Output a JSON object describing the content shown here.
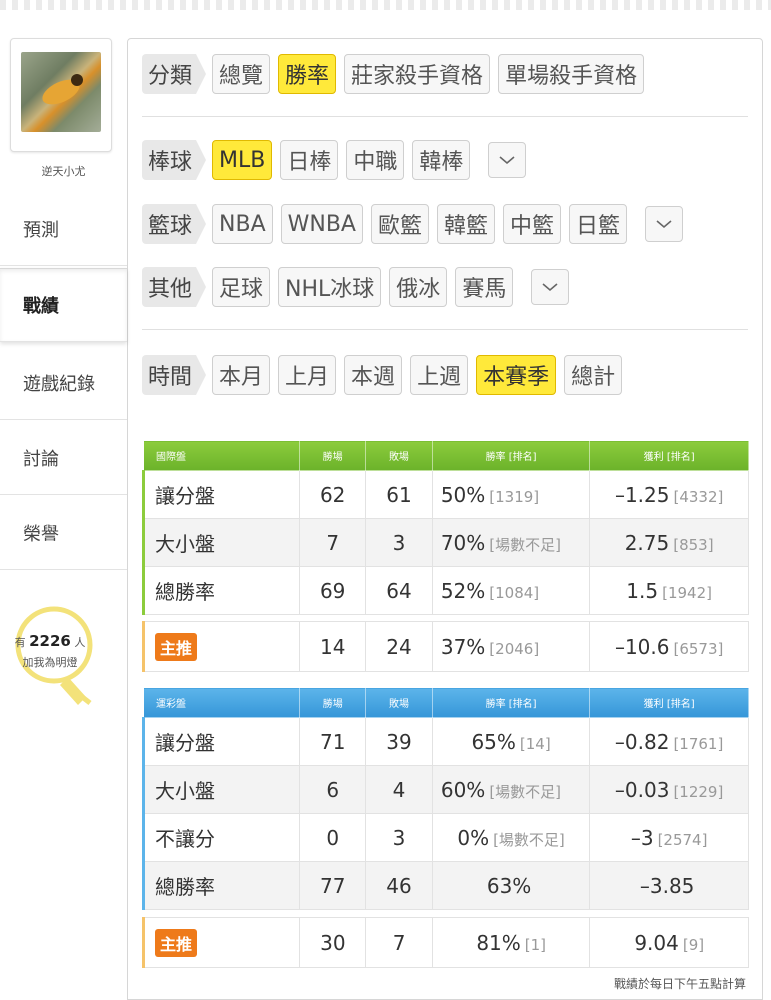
{
  "user": {
    "name": "逆天小尤"
  },
  "sidebar": {
    "items": [
      {
        "label": "預測"
      },
      {
        "label": "戰績"
      },
      {
        "label": "遊戲紀錄"
      },
      {
        "label": "討論"
      },
      {
        "label": "榮譽"
      }
    ],
    "light": {
      "prefix": "有",
      "count": "2226",
      "suffix": "人",
      "caption": "加我為明燈"
    }
  },
  "filters": {
    "category": {
      "label": "分類",
      "options": [
        "總覽",
        "勝率",
        "莊家殺手資格",
        "單場殺手資格"
      ],
      "selected": "勝率"
    },
    "baseball": {
      "label": "棒球",
      "options": [
        "MLB",
        "日棒",
        "中職",
        "韓棒"
      ],
      "selected": "MLB"
    },
    "basketball": {
      "label": "籃球",
      "options": [
        "NBA",
        "WNBA",
        "歐籃",
        "韓籃",
        "中籃",
        "日籃"
      ]
    },
    "other": {
      "label": "其他",
      "options": [
        "足球",
        "NHL冰球",
        "俄冰",
        "賽馬"
      ]
    },
    "time": {
      "label": "時間",
      "options": [
        "本月",
        "上月",
        "本週",
        "上週",
        "本賽季",
        "總計"
      ],
      "selected": "本賽季"
    }
  },
  "intl_table": {
    "headers": [
      "國際盤",
      "勝場",
      "敗場",
      "勝率 [排名]",
      "獲利 [排名]"
    ],
    "rows": [
      {
        "name": "讓分盤",
        "win": "62",
        "lose": "61",
        "rate": "50%",
        "rate_rank": "[1319]",
        "profit": "–1.25",
        "profit_rank": "[4332]"
      },
      {
        "name": "大小盤",
        "win": "7",
        "lose": "3",
        "rate": "70%",
        "rate_rank": "[場數不足]",
        "profit": "2.75",
        "profit_rank": "[853]"
      },
      {
        "name": "總勝率",
        "win": "69",
        "lose": "64",
        "rate": "52%",
        "rate_rank": "[1084]",
        "profit": "1.5",
        "profit_rank": "[1942]"
      }
    ],
    "main_pick": {
      "tag": "主推",
      "win": "14",
      "lose": "24",
      "rate": "37%",
      "rate_rank": "[2046]",
      "profit": "–10.6",
      "profit_rank": "[6573]"
    }
  },
  "lottery_table": {
    "headers": [
      "運彩盤",
      "勝場",
      "敗場",
      "勝率 [排名]",
      "獲利 [排名]"
    ],
    "rows": [
      {
        "name": "讓分盤",
        "win": "71",
        "lose": "39",
        "rate": "65%",
        "rate_rank": "[14]",
        "profit": "–0.82",
        "profit_rank": "[1761]"
      },
      {
        "name": "大小盤",
        "win": "6",
        "lose": "4",
        "rate": "60%",
        "rate_rank": "[場數不足]",
        "profit": "–0.03",
        "profit_rank": "[1229]"
      },
      {
        "name": "不讓分",
        "win": "0",
        "lose": "3",
        "rate": "0%",
        "rate_rank": "[場數不足]",
        "profit": "–3",
        "profit_rank": "[2574]"
      },
      {
        "name": "總勝率",
        "win": "77",
        "lose": "46",
        "rate": "63%",
        "rate_rank": "",
        "profit": "–3.85",
        "profit_rank": ""
      }
    ],
    "main_pick": {
      "tag": "主推",
      "win": "30",
      "lose": "7",
      "rate": "81%",
      "rate_rank": "[1]",
      "profit": "9.04",
      "profit_rank": "[9]"
    }
  },
  "footnote": "戰績於每日下午五點計算",
  "colors": {
    "selected": "#ffe93a",
    "intl_header": "#7bbf32",
    "lottery_header": "#45a5e0",
    "tag": "#ee7a1a"
  }
}
